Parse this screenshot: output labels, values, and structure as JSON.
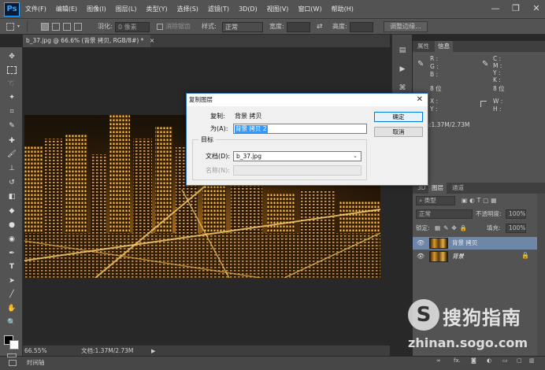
{
  "app": {
    "logo": "Ps",
    "menu": [
      "文件(F)",
      "编辑(E)",
      "图像(I)",
      "图层(L)",
      "类型(Y)",
      "选择(S)",
      "滤镜(T)",
      "3D(D)",
      "视图(V)",
      "窗口(W)",
      "帮助(H)"
    ],
    "window_controls": [
      "—",
      "❐",
      "✕"
    ]
  },
  "options_bar": {
    "feather_label": "羽化:",
    "feather_value": "0 像素",
    "antialias_label": "消除锯齿",
    "style_label": "样式:",
    "style_value": "正常",
    "width_label": "宽度:",
    "height_label": "高度:",
    "adjust_edge": "调整边缘..."
  },
  "document": {
    "tab_title": "b_37.jpg @ 66.6% (背景 拷贝, RGB/8#) *",
    "tab_close": "×",
    "zoom": "66.55%",
    "doc_size": "文档:1.37M/2.73M",
    "timeline": "时间轴"
  },
  "info_panel": {
    "tabs": [
      "属性",
      "信息"
    ],
    "active_tab": "信息",
    "left_channels": [
      "R :",
      "G :",
      "B :"
    ],
    "right_channels": [
      "C :",
      "M :",
      "Y :",
      "K :"
    ],
    "bit_left": "8 位",
    "bit_right": "8 位",
    "x_label": "X :",
    "y_label": "Y :",
    "w_label": "W :",
    "h_label": "H :",
    "doc_size": "文档:1.37M/2.73M"
  },
  "layers_panel": {
    "tabs": [
      "3D",
      "图层",
      "通道"
    ],
    "active_tab": "图层",
    "filter_kind": "类型",
    "blend_mode": "正常",
    "opacity_label": "不透明度:",
    "opacity_value": "100%",
    "lock_label": "锁定:",
    "fill_label": "填充:",
    "fill_value": "100%",
    "layers": [
      {
        "name": "背景 拷贝",
        "selected": true,
        "locked": false
      },
      {
        "name": "背景",
        "selected": false,
        "locked": true
      }
    ],
    "footer_icons": [
      "link-icon",
      "fx-icon",
      "mask-icon",
      "adjustment-icon",
      "group-icon",
      "new-layer-icon",
      "trash-icon"
    ],
    "fx_text": "fx."
  },
  "dialog": {
    "title": "复制图层",
    "close": "✕",
    "source_label": "复制:",
    "source_value": "背景 拷贝",
    "as_label": "为(A):",
    "as_value": "背景 拷贝 2",
    "ok": "确定",
    "cancel": "取消",
    "destination_legend": "目标",
    "document_label": "文档(D):",
    "document_value": "b_37.jpg",
    "name_label": "名称(N):"
  },
  "watermark": {
    "logo_letter": "S",
    "text": "搜狗指南",
    "url": "zhinan.sogo.com"
  }
}
